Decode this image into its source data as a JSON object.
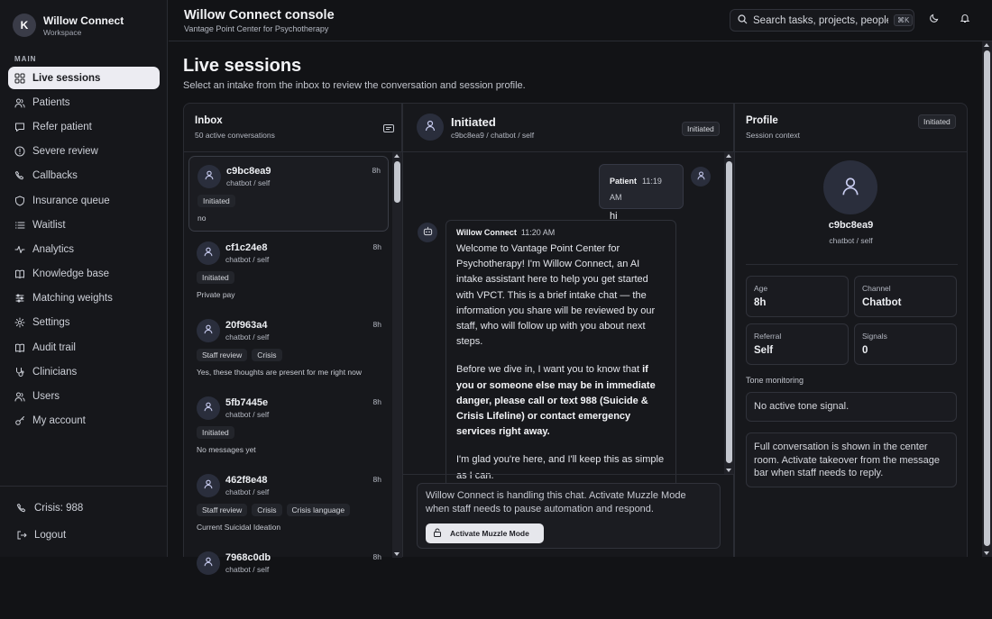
{
  "brand": {
    "initial": "K",
    "name": "Willow Connect",
    "sub": "Workspace"
  },
  "sidebar": {
    "section_label": "MAIN",
    "items": [
      {
        "label": "Live sessions",
        "icon": "grid-icon"
      },
      {
        "label": "Patients",
        "icon": "users-icon"
      },
      {
        "label": "Refer patient",
        "icon": "chat-icon"
      },
      {
        "label": "Severe review",
        "icon": "alert-icon"
      },
      {
        "label": "Callbacks",
        "icon": "phone-icon"
      },
      {
        "label": "Insurance queue",
        "icon": "shield-icon"
      },
      {
        "label": "Waitlist",
        "icon": "list-icon"
      },
      {
        "label": "Analytics",
        "icon": "pulse-icon"
      },
      {
        "label": "Knowledge base",
        "icon": "book-icon"
      },
      {
        "label": "Matching weights",
        "icon": "sliders-icon"
      },
      {
        "label": "Settings",
        "icon": "gear-icon"
      },
      {
        "label": "Audit trail",
        "icon": "book-icon"
      },
      {
        "label": "Clinicians",
        "icon": "stethoscope-icon"
      },
      {
        "label": "Users",
        "icon": "users-icon"
      },
      {
        "label": "My account",
        "icon": "key-icon"
      }
    ],
    "crisis": "Crisis: 988",
    "logout": "Logout"
  },
  "header": {
    "title": "Willow Connect console",
    "subtitle": "Vantage Point Center for Psychotherapy",
    "search_placeholder": "Search tasks, projects, people...",
    "shortcut": "⌘K"
  },
  "page": {
    "title": "Live sessions",
    "subtitle": "Select an intake from the inbox to review the conversation and session profile."
  },
  "inbox": {
    "title": "Inbox",
    "count": "50 active conversations",
    "conversations": [
      {
        "id": "c9bc8ea9",
        "meta": "chatbot / self",
        "time": "8h",
        "tags": [
          "Initiated"
        ],
        "preview": "no"
      },
      {
        "id": "cf1c24e8",
        "meta": "chatbot / self",
        "time": "8h",
        "tags": [
          "Initiated"
        ],
        "preview": "Private pay"
      },
      {
        "id": "20f963a4",
        "meta": "chatbot / self",
        "time": "8h",
        "tags": [
          "Staff review",
          "Crisis"
        ],
        "preview": "Yes, these thoughts are present for me right now"
      },
      {
        "id": "5fb7445e",
        "meta": "chatbot / self",
        "time": "8h",
        "tags": [
          "Initiated"
        ],
        "preview": "No messages yet"
      },
      {
        "id": "462f8e48",
        "meta": "chatbot / self",
        "time": "8h",
        "tags": [
          "Staff review",
          "Crisis",
          "Crisis language"
        ],
        "preview": "Current Suicidal Ideation"
      },
      {
        "id": "7968c0db",
        "meta": "chatbot / self",
        "time": "8h",
        "tags": [],
        "preview": ""
      }
    ]
  },
  "chat": {
    "title": "Initiated",
    "sub": "c9bc8ea9 / chatbot / self",
    "status": "Initiated",
    "patient_msg": {
      "sender": "Patient",
      "time": "11:19 AM",
      "text": "hi"
    },
    "bot_msg": {
      "sender": "Willow Connect",
      "time": "11:20 AM",
      "p1": "Welcome to Vantage Point Center for Psychotherapy! I'm Willow Connect, an AI intake assistant here to help you get started with VPCT. This is a brief intake chat — the information you share will be reviewed by our staff, who will follow up with you about next steps.",
      "p2_lead": "Before we dive in, I want you to know that ",
      "p2_bold": "if you or someone else may be in immediate danger, please call or text 988 (Suicide & Crisis Lifeline) or contact emergency services right away.",
      "p3": "I'm glad you're here, and I'll keep this as simple as I can."
    },
    "composer_text": "Willow Connect is handling this chat. Activate Muzzle Mode when staff needs to pause automation and respond.",
    "muzzle_label": "Activate Muzzle Mode"
  },
  "profile": {
    "title": "Profile",
    "sub": "Session context",
    "status": "Initiated",
    "name": "c9bc8ea9",
    "meta": "chatbot / self",
    "cards": [
      {
        "label": "Age",
        "value": "8h"
      },
      {
        "label": "Channel",
        "value": "Chatbot"
      },
      {
        "label": "Referral",
        "value": "Self"
      },
      {
        "label": "Signals",
        "value": "0"
      }
    ],
    "tone_label": "Tone monitoring",
    "tone_value": "No active tone signal.",
    "note": "Full conversation is shown in the center room. Activate takeover from the message bar when staff needs to reply."
  },
  "colors": {
    "background": "#121316",
    "active_nav": "#ececf2",
    "panel": "#17181c"
  }
}
